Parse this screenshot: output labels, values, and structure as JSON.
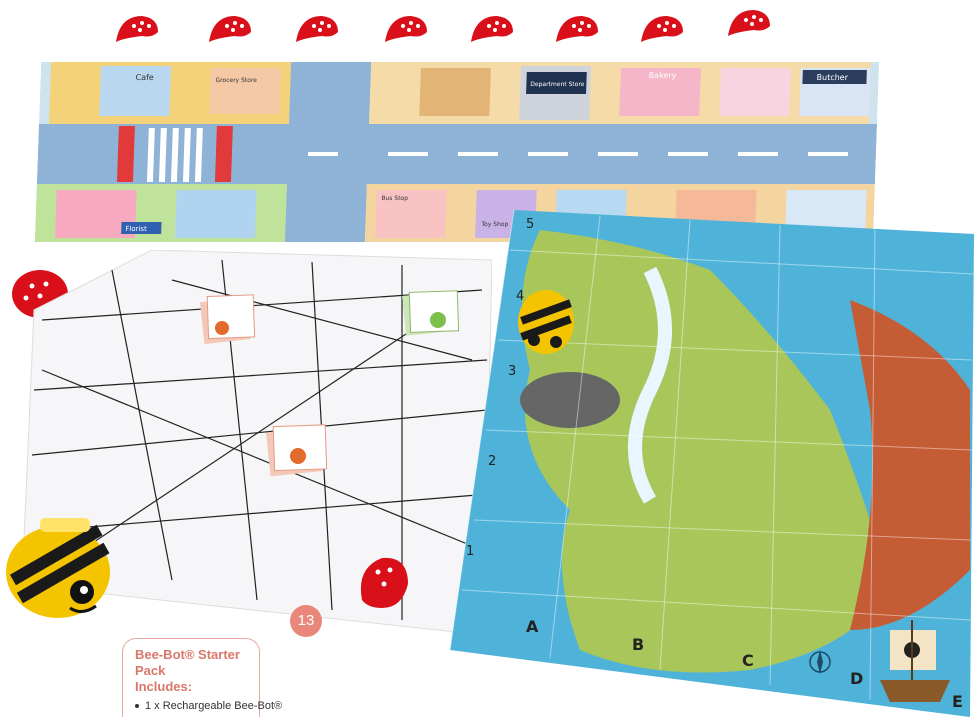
{
  "town_mat": {
    "shop_signs": [
      "Cafe",
      "Grocery Store",
      "Department Store",
      "Bakery",
      "Butcher",
      "Florist",
      "Toy Shop",
      "Bus Stop"
    ]
  },
  "island_mat": {
    "row_labels": [
      "5",
      "4",
      "3",
      "2",
      "1"
    ],
    "column_labels": [
      "A",
      "B",
      "C",
      "D",
      "E"
    ]
  },
  "product_card": {
    "title_line1": "Bee-Bot® Starter Pack",
    "title_line2": "Includes:",
    "items": [
      "1 x Rechargeable Bee-Bot®"
    ]
  },
  "page_number": "13",
  "colors": {
    "accent": "#e9877b",
    "card_border": "#e9a69c",
    "shell_red": "#d9101a",
    "bee_yellow": "#f5c400",
    "sea": "#4fb3d9"
  }
}
